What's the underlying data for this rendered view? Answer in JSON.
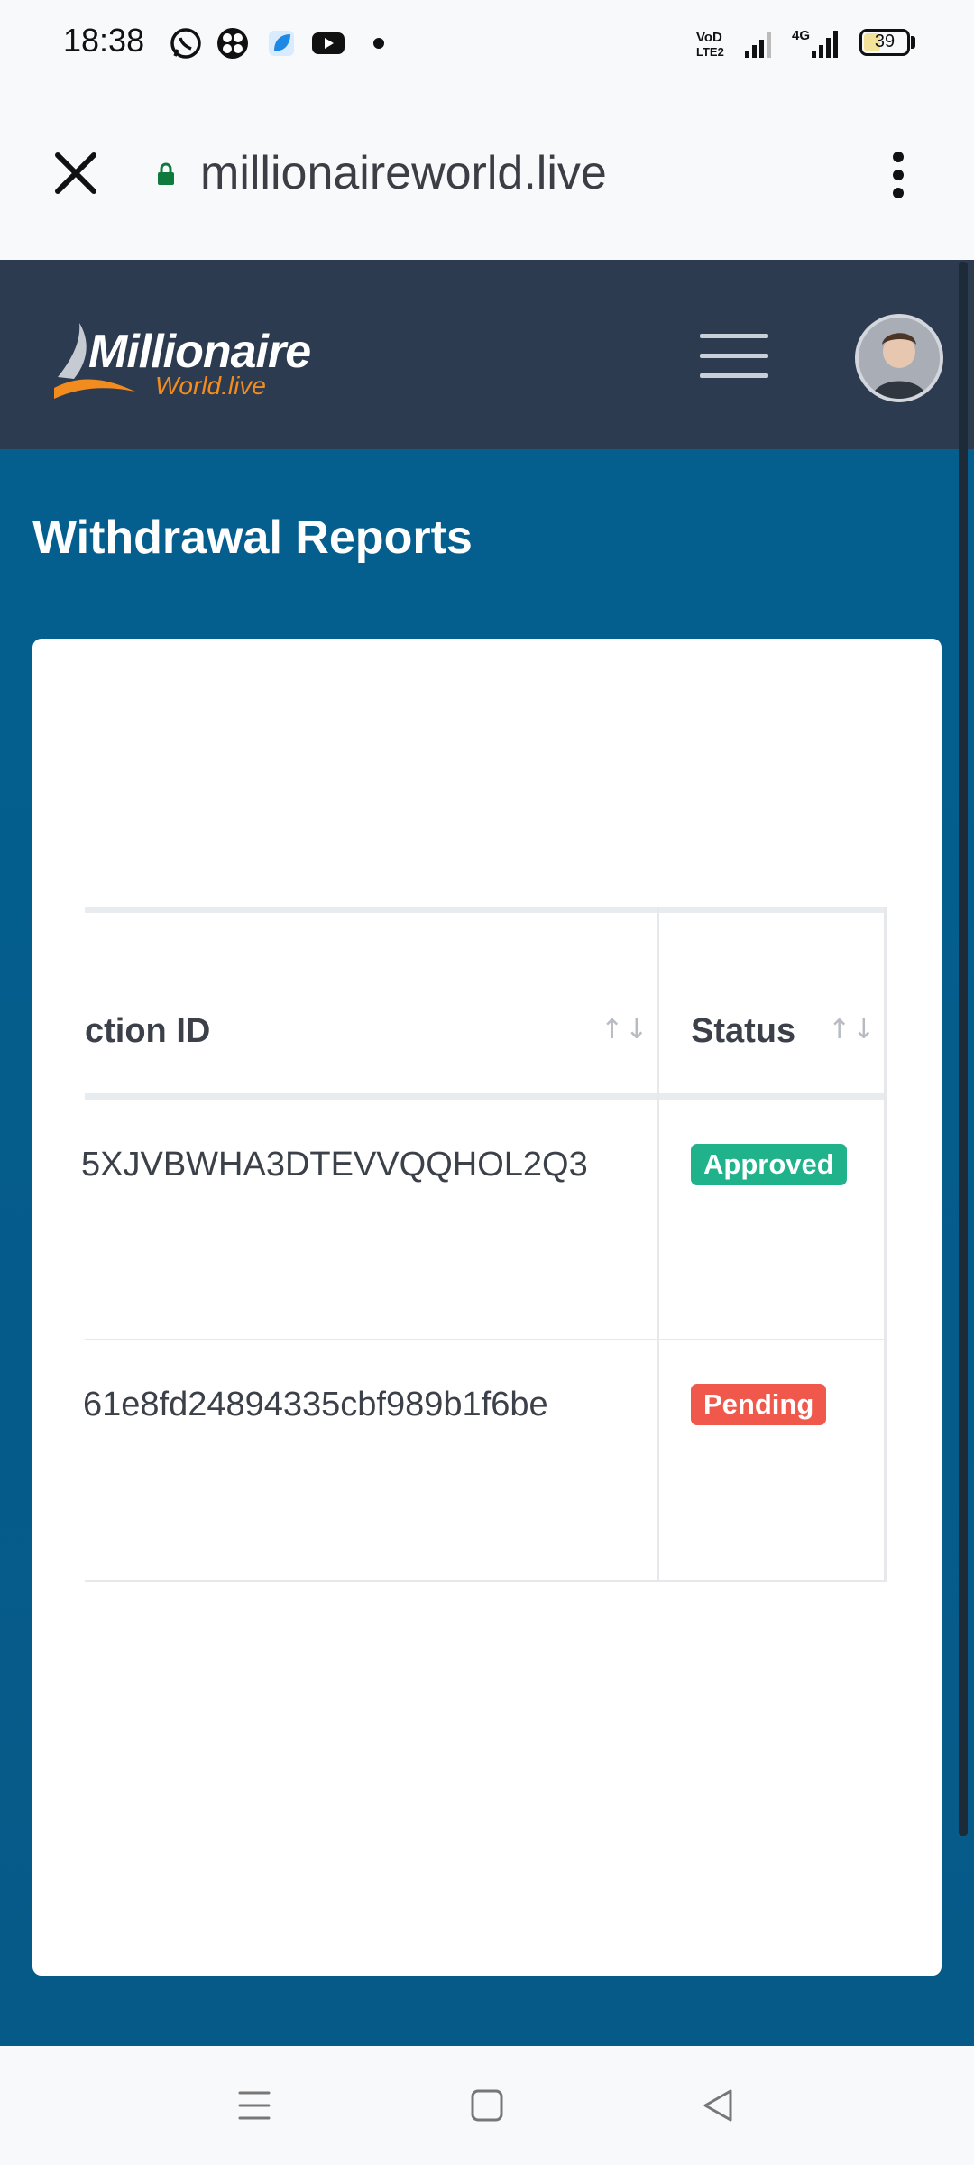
{
  "status_bar": {
    "time": "18:38",
    "network_label": "4G",
    "volte_label": "VoLTE",
    "battery": "39",
    "icons": [
      "whatsapp-icon",
      "app-icon",
      "app-icon-blue",
      "youtube-icon",
      "notification-dot",
      "volte-icon",
      "signal-icon",
      "signal-4g-icon",
      "battery-icon"
    ]
  },
  "browser": {
    "url": "millionaireworld.live",
    "icons": [
      "close-icon",
      "lock-icon",
      "more-vert-icon"
    ]
  },
  "header": {
    "logo_main": "Millionaire",
    "logo_sub": "World.live",
    "icons": [
      "hamburger-menu-icon",
      "user-avatar"
    ],
    "colors": {
      "header_bg": "#2c3b4f",
      "logo_accent": "#f28c1e"
    }
  },
  "page": {
    "title": "Withdrawal Reports",
    "colors": {
      "main_bg": "#045f8f"
    }
  },
  "table": {
    "columns": [
      {
        "label": "ction ID",
        "sort_icon": "↑↓"
      },
      {
        "label": "Status",
        "sort_icon": "↑↓"
      }
    ],
    "rows": [
      {
        "transaction_id": "5XJVBWHA3DTEVVQQHOL2Q3",
        "status": "Approved",
        "status_color": "#20b38b"
      },
      {
        "transaction_id": "61e8fd24894335cbf989b1f6be",
        "status": "Pending",
        "status_color": "#f0584b"
      }
    ]
  },
  "nav_bar": {
    "icons": [
      "recents-icon",
      "home-icon",
      "back-icon"
    ]
  }
}
